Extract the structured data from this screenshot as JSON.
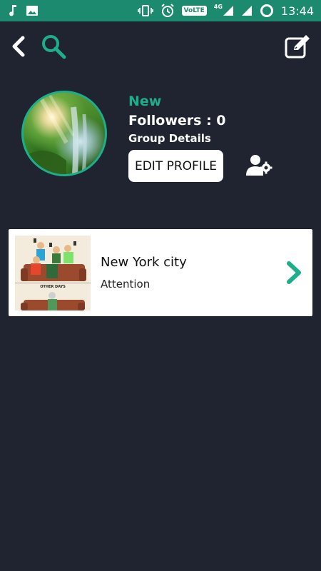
{
  "status_bar": {
    "time": "13:44",
    "volte": "VoLTE",
    "network": "4G",
    "icons": [
      "music-note-icon",
      "image-icon",
      "vibrate-icon",
      "alarm-icon",
      "volte-icon",
      "signal-icon",
      "signal-icon",
      "data-saver-icon"
    ],
    "background": "#1c8a6e"
  },
  "toolbar": {
    "icons": [
      "back-arrow-icon",
      "search-icon",
      "edit-icon"
    ],
    "accent": "#1fae8a"
  },
  "profile": {
    "name": "New",
    "followers_label": "Followers : 0",
    "group_details_label": "Group Details",
    "edit_profile_label": "EDIT PROFILE",
    "settings_icon": "user-settings-icon"
  },
  "list": {
    "items": [
      {
        "title": "New York city",
        "subtitle": "Attention",
        "thumbnail_caption": "OTHER DAYS",
        "icon": "chevron-right-icon"
      }
    ]
  },
  "colors": {
    "background": "#1f2430",
    "accent": "#1fae8a",
    "card": "#ffffff"
  }
}
